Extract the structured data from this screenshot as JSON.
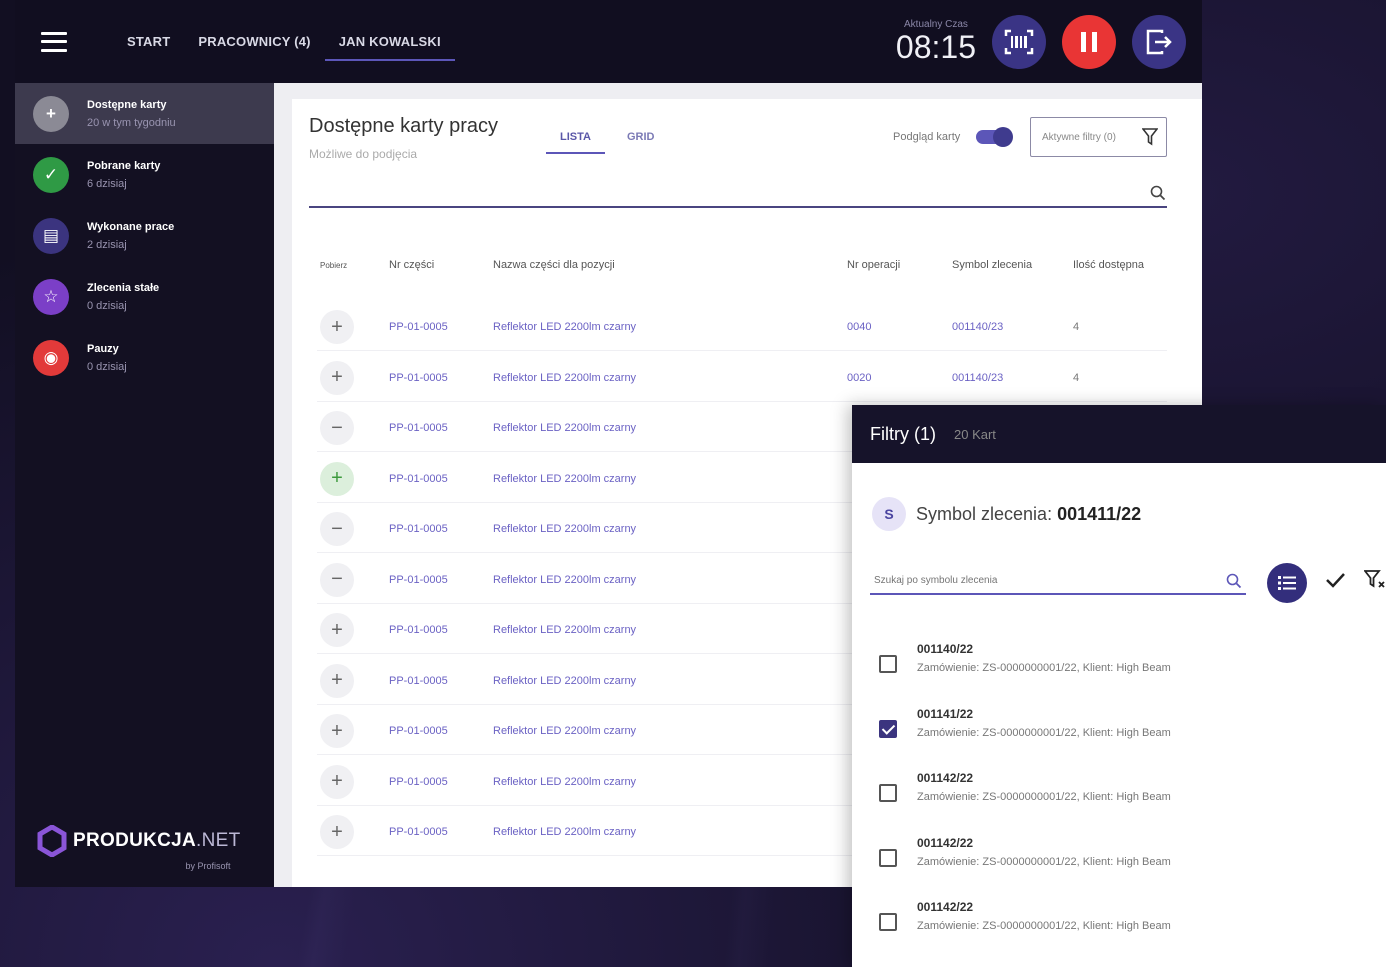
{
  "topbar": {
    "nav": [
      "START",
      "PRACOWNICY (4)",
      "JAN KOWALSKI"
    ],
    "clock_label": "Aktualny Czas",
    "clock_time": "08:15"
  },
  "sidebar": {
    "items": [
      {
        "title": "Dostępne karty",
        "sub": "20 w tym tygodniu",
        "color": "#8b8a95",
        "glyph": "+"
      },
      {
        "title": "Pobrane karty",
        "sub": "6 dzisiaj",
        "color": "#2f9a45",
        "glyph": "✓"
      },
      {
        "title": "Wykonane prace",
        "sub": "2 dzisiaj",
        "color": "#3b347f",
        "glyph": "▤"
      },
      {
        "title": "Zlecenia stałe",
        "sub": "0 dzisiaj",
        "color": "#7b3fc7",
        "glyph": "☆"
      },
      {
        "title": "Pauzy",
        "sub": "0 dzisiaj",
        "color": "#e23a3a",
        "glyph": "◉"
      }
    ],
    "logo_main": "PRODUKCJA",
    "logo_suffix": ".NET",
    "logo_sub": "by Profisoft"
  },
  "main": {
    "title": "Dostępne karty pracy",
    "subtitle": "Możliwe do podjęcia",
    "tab_list": "LISTA",
    "tab_grid": "GRID",
    "preview_label": "Podgląd karty",
    "filter_button": "Aktywne filtry (0)",
    "headers": [
      "Pobierz",
      "Nr części",
      "Nazwa części dla pozycji",
      "Nr operacji",
      "Symbol zlecenia",
      "Ilość dostępna"
    ],
    "rows": [
      {
        "action": "+",
        "part": "PP-01-0005",
        "name": "Reflektor LED 2200lm czarny",
        "op": "0040",
        "order": "001140/23",
        "qty": "4"
      },
      {
        "action": "+",
        "part": "PP-01-0005",
        "name": "Reflektor LED 2200lm czarny",
        "op": "0020",
        "order": "001140/23",
        "qty": "4"
      },
      {
        "action": "−",
        "part": "PP-01-0005",
        "name": "Reflektor LED 2200lm czarny",
        "op": "",
        "order": "",
        "qty": ""
      },
      {
        "action": "+",
        "part": "PP-01-0005",
        "name": "Reflektor LED 2200lm czarny",
        "op": "",
        "order": "",
        "qty": ""
      },
      {
        "action": "−",
        "part": "PP-01-0005",
        "name": "Reflektor LED 2200lm czarny",
        "op": "",
        "order": "",
        "qty": ""
      },
      {
        "action": "−",
        "part": "PP-01-0005",
        "name": "Reflektor LED 2200lm czarny",
        "op": "",
        "order": "",
        "qty": ""
      },
      {
        "action": "+",
        "part": "PP-01-0005",
        "name": "Reflektor LED 2200lm czarny",
        "op": "",
        "order": "",
        "qty": ""
      },
      {
        "action": "+",
        "part": "PP-01-0005",
        "name": "Reflektor LED 2200lm czarny",
        "op": "",
        "order": "",
        "qty": ""
      },
      {
        "action": "+",
        "part": "PP-01-0005",
        "name": "Reflektor LED 2200lm czarny",
        "op": "",
        "order": "",
        "qty": ""
      },
      {
        "action": "+",
        "part": "PP-01-0005",
        "name": "Reflektor LED 2200lm czarny",
        "op": "",
        "order": "",
        "qty": ""
      },
      {
        "action": "+",
        "part": "PP-01-0005",
        "name": "Reflektor LED 2200lm czarny",
        "op": "",
        "order": "",
        "qty": ""
      }
    ]
  },
  "filter_panel": {
    "title": "Filtry (1)",
    "count": "20 Kart",
    "badge": "S",
    "symbol_label": "Symbol zlecenia:",
    "symbol_value": "001411/22",
    "search_placeholder": "Szukaj po symbolu zlecenia",
    "items": [
      {
        "title": "001140/22",
        "sub": "Zamówienie: ZS-0000000001/22, Klient: High Beam",
        "checked": false
      },
      {
        "title": "001141/22",
        "sub": "Zamówienie: ZS-0000000001/22, Klient: High Beam",
        "checked": true
      },
      {
        "title": "001142/22",
        "sub": "Zamówienie: ZS-0000000001/22, Klient: High Beam",
        "checked": false
      },
      {
        "title": "001142/22",
        "sub": "Zamówienie: ZS-0000000001/22, Klient: High Beam",
        "checked": false
      },
      {
        "title": "001142/22",
        "sub": "Zamówienie: ZS-0000000001/22, Klient: High Beam",
        "checked": false
      }
    ]
  }
}
